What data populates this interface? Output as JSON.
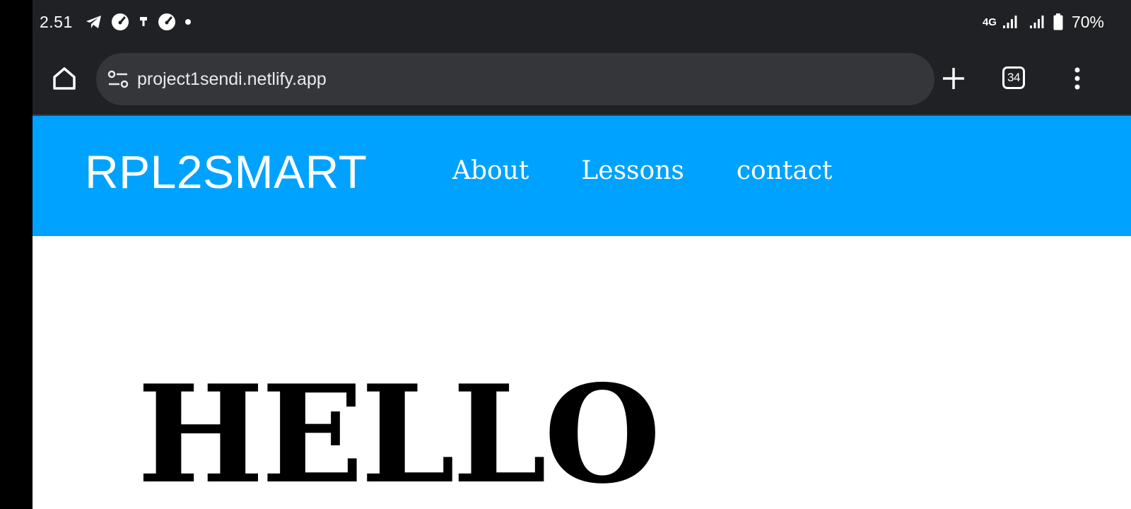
{
  "status_bar": {
    "time": "2.51",
    "notification_icons": [
      "telegram-icon",
      "gauge-icon",
      "usb-icon",
      "gauge-icon",
      "dot-icon"
    ],
    "network_type": "4G",
    "battery_percent": "70%"
  },
  "browser": {
    "url": "project1sendi.netlify.app",
    "tab_count": "34",
    "icons": [
      "home-icon",
      "site-settings-icon",
      "plus-icon",
      "tabs-icon",
      "more-vert-icon"
    ]
  },
  "site": {
    "logo": "RPL2SMART",
    "nav": [
      {
        "label": "About"
      },
      {
        "label": "Lessons"
      },
      {
        "label": "contact"
      }
    ],
    "hero_title": "HELLO",
    "colors": {
      "header_bg": "#00a2ff",
      "header_text": "#ffffff",
      "hero_text": "#000000"
    }
  }
}
